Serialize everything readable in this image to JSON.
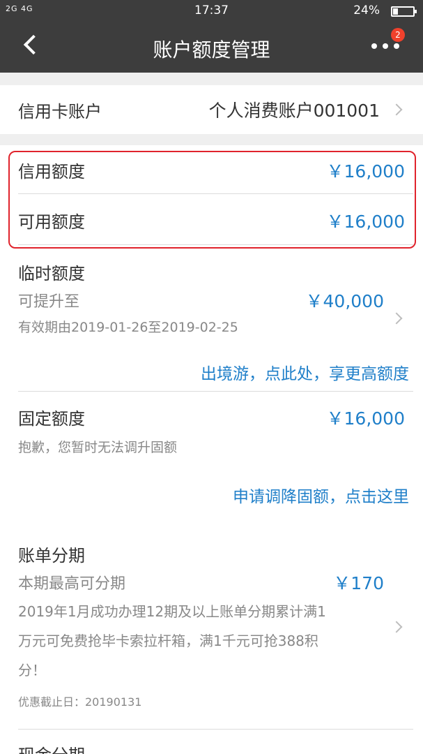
{
  "status_bar": {
    "signal": "2G 4G",
    "time": "17:37",
    "battery": "24%",
    "battery_level": 0.24
  },
  "header": {
    "title": "账户额度管理",
    "badge_count": "2"
  },
  "account": {
    "label": "信用卡账户",
    "value": "个人消费账户001001"
  },
  "credit_limit": {
    "label": "信用额度",
    "value": "￥16,000"
  },
  "available_limit": {
    "label": "可用额度",
    "value": "￥16,000"
  },
  "temporary_limit": {
    "label": "临时额度",
    "sub_label": "可提升至",
    "value": "￥40,000",
    "validity": "有效期由2019-01-26至2019-02-25",
    "link": "出境游，点此处，享更高额度"
  },
  "fixed_limit": {
    "label": "固定额度",
    "value": "￥16,000",
    "note": "抱歉，您暂时无法调升固额",
    "link": "申请调降固额，点击这里"
  },
  "bill_installment": {
    "label": "账单分期",
    "sub_label": "本期最高可分期",
    "value": "￥170",
    "promo_line1": "2019年1月成功办理12期及以上账单分期累计满1",
    "promo_line2": "万元可免费抢毕卡索拉杆箱，满1千元可抢388积",
    "promo_line3": "分！",
    "deadline": "优惠截止日：20190131"
  },
  "cash_installment": {
    "label": "现金分期"
  },
  "colors": {
    "accent": "#1f7fc9",
    "header_bg": "#3d3d3d",
    "highlight_border": "#e0232c",
    "badge": "#f0412c"
  }
}
